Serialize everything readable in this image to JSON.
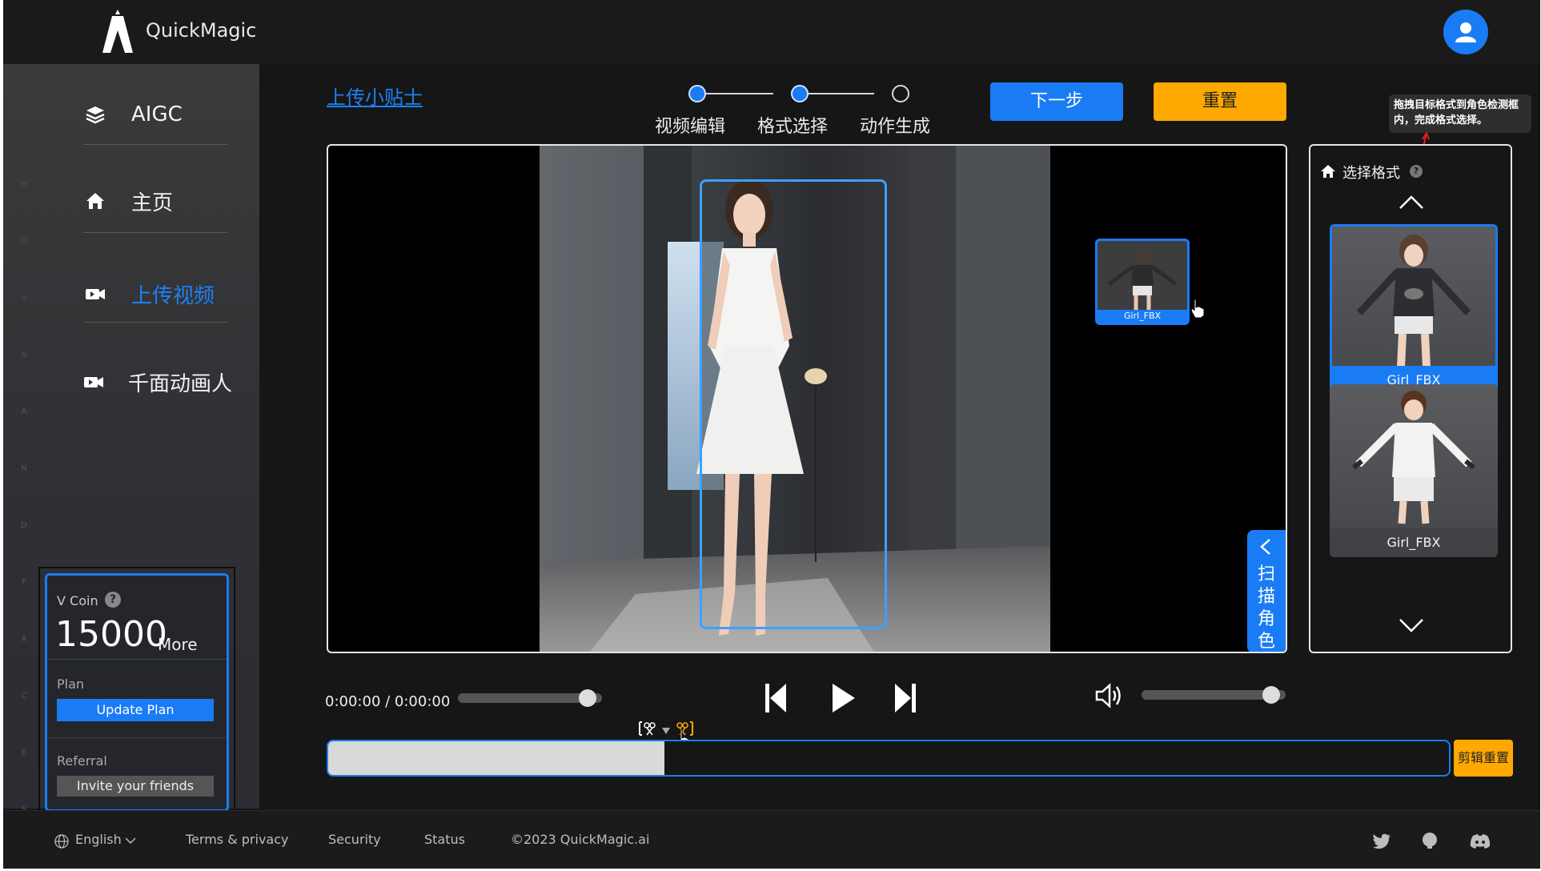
{
  "header": {
    "brand": "QuickMagic"
  },
  "sidebar": {
    "side_letters": [
      "H",
      "O",
      "U",
      "S",
      "A",
      "N",
      "D",
      "F",
      "A",
      "C",
      "E",
      "S"
    ],
    "items": [
      {
        "label": "AIGC",
        "icon": "layers-icon"
      },
      {
        "label": "主页",
        "icon": "home-icon"
      },
      {
        "label": "上传视频",
        "icon": "video-camera-icon",
        "active": true
      },
      {
        "label": "千面动画人",
        "icon": "video-camera-icon"
      }
    ],
    "vcoin": {
      "title": "V Coin",
      "help": "?",
      "amount": "15000",
      "more": "More",
      "plan_label": "Plan",
      "update_plan": "Update Plan",
      "referral_label": "Referral",
      "invite": "Invite your friends"
    }
  },
  "main": {
    "tips_link": "上传小贴士",
    "steps": [
      {
        "label": "视频编辑",
        "state": "done"
      },
      {
        "label": "格式选择",
        "state": "current"
      },
      {
        "label": "动作生成",
        "state": "todo"
      }
    ],
    "next_button": "下一步",
    "reset_button": "重置",
    "tooltip": "拖拽目标格式到角色检测框内，完成格式选择。",
    "viewer": {
      "dragged_model_label": "Girl_FBX",
      "scan_button": "扫描角色"
    },
    "format_panel": {
      "title": "选择格式",
      "help": "?",
      "cards": [
        {
          "label": "Girl_FBX",
          "selected": true
        },
        {
          "label": "Girl_FBX",
          "selected": false
        }
      ]
    },
    "player": {
      "time": "0:00:00 / 0:00:00",
      "progress": 0.9,
      "volume": 0.9
    },
    "timeline": {
      "clip_fraction": 0.3,
      "clip_reset": "剪辑重置"
    }
  },
  "footer": {
    "language": "English",
    "terms": "Terms & privacy",
    "security": "Security",
    "status": "Status",
    "copyright": "©2023 QuickMagic.ai"
  },
  "colors": {
    "accent": "#1a7cf5",
    "warning": "#ffa800",
    "background": "#161616"
  }
}
